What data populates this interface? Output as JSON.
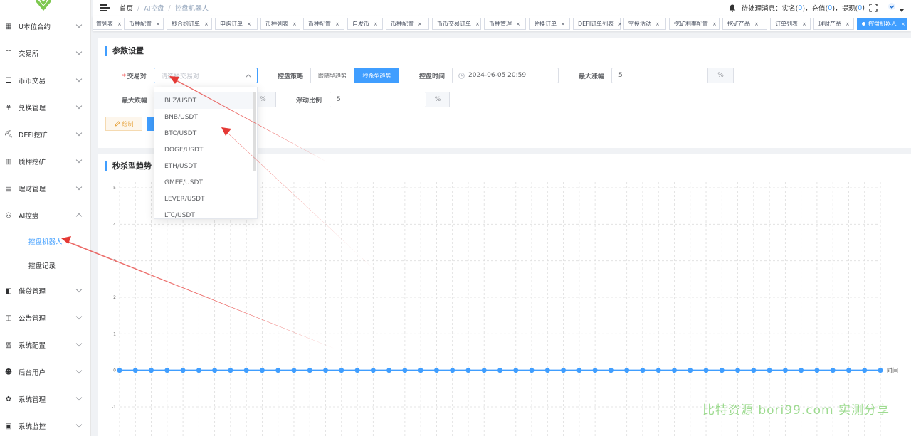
{
  "sidebar": {
    "items": [
      {
        "label": "U本位合约",
        "icon": "grid-icon",
        "glyph": "▦"
      },
      {
        "label": "交易所",
        "icon": "list-icon",
        "glyph": "☷"
      },
      {
        "label": "币币交易",
        "icon": "list-icon",
        "glyph": "☰"
      },
      {
        "label": "兑换管理",
        "icon": "yen-icon",
        "glyph": "¥"
      },
      {
        "label": "DEFI挖矿",
        "icon": "person-icon",
        "glyph": "⛏"
      },
      {
        "label": "质押挖矿",
        "icon": "bar-chart-icon",
        "glyph": "▥"
      },
      {
        "label": "理财管理",
        "icon": "document-icon",
        "glyph": "▤"
      },
      {
        "label": "AI控盘",
        "icon": "robot-icon",
        "glyph": "⚇"
      },
      {
        "label": "借贷管理",
        "icon": "book-icon",
        "glyph": "◧"
      },
      {
        "label": "公告管理",
        "icon": "open-book-icon",
        "glyph": "◫"
      },
      {
        "label": "系统配置",
        "icon": "config-icon",
        "glyph": "▨"
      },
      {
        "label": "后台用户",
        "icon": "users-icon",
        "glyph": "☻"
      },
      {
        "label": "系统管理",
        "icon": "gear-icon",
        "glyph": "✿"
      },
      {
        "label": "系统监控",
        "icon": "monitor-icon",
        "glyph": "▣"
      }
    ],
    "sub_items": [
      {
        "label": "控盘机器人",
        "active": true
      },
      {
        "label": "控盘记录",
        "active": false
      }
    ]
  },
  "header": {
    "breadcrumb": [
      "首页",
      "AI控盘",
      "控盘机器人"
    ],
    "pending_label": "待处理消息：实名(",
    "count_realname": "0",
    "recharge_label": ")，充值(",
    "count_recharge": "0",
    "withdraw_label": ")，提现(",
    "count_withdraw": "0",
    "close_paren": ")"
  },
  "tags": [
    "置列表",
    "币种配置",
    "秒合约订单",
    "申购订单",
    "币种列表",
    "币种配置",
    "自发币",
    "币种配置",
    "币币交易订单",
    "币种管理",
    "兑换订单",
    "DEFI订单列表",
    "空投活动",
    "挖矿利率配置",
    "挖矿产品",
    "订单列表",
    "理财产品",
    "控盘机器人"
  ],
  "form": {
    "title": "参数设置",
    "pair_label": "交易对",
    "pair_placeholder": "请选择交易对",
    "strategy_label": "控盘策略",
    "strategy_option1": "跟随型趋势",
    "strategy_option2": "秒杀型趋势",
    "time_label": "控盘时间",
    "time_value": "2024-06-05 20:59",
    "max_rise_label": "最大涨幅",
    "max_rise_value": "5",
    "max_fall_label": "最大跌幅",
    "float_label": "浮动比例",
    "float_value": "5",
    "percent": "%",
    "draw_label": "绘制"
  },
  "dropdown": {
    "options": [
      "BLZ/USDT",
      "BNB/USDT",
      "BTC/USDT",
      "DOGE/USDT",
      "ETH/USDT",
      "GMEE/USDT",
      "LEVER/USDT",
      "LTC/USDT"
    ]
  },
  "chart_title": "秒杀型趋势",
  "chart_data": {
    "type": "line",
    "xlabel": "时间",
    "ylim": [
      -1,
      5
    ],
    "yticks": [
      "5",
      "4",
      "3",
      "2",
      "1",
      "0",
      "-1"
    ],
    "point_count": 49,
    "values_all": 0,
    "color": "#409eff"
  },
  "watermark": "比特资源 bori99.com 实测分享",
  "colors": {
    "accent": "#409eff",
    "arrow": "#e53935"
  }
}
